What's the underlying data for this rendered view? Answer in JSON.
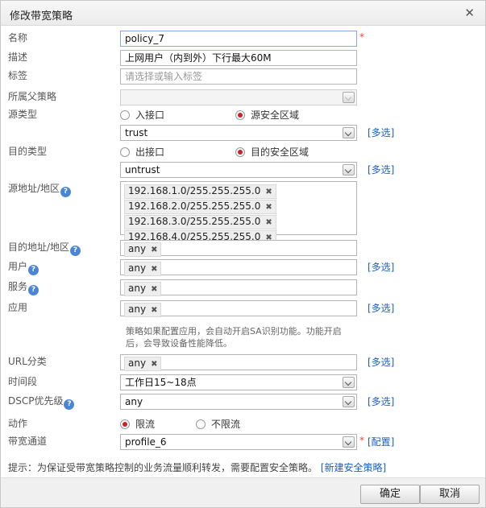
{
  "dialog": {
    "title": "修改带宽策略",
    "close_icon": "✕"
  },
  "fields": {
    "name": {
      "label": "名称",
      "value": "policy_7",
      "required_mark": "*"
    },
    "description": {
      "label": "描述",
      "value": "上网用户（内到外）下行最大60M"
    },
    "tag": {
      "label": "标签",
      "placeholder": "请选择或输入标签"
    },
    "parent_policy": {
      "label": "所属父策略",
      "value": ""
    },
    "source_type": {
      "label": "源类型",
      "options": [
        {
          "label": "入接口",
          "checked": false
        },
        {
          "label": "源安全区域",
          "checked": true
        }
      ],
      "zone_value": "trust",
      "more": "[多选]"
    },
    "dest_type": {
      "label": "目的类型",
      "options": [
        {
          "label": "出接口",
          "checked": false
        },
        {
          "label": "目的安全区域",
          "checked": true
        }
      ],
      "zone_value": "untrust",
      "more": "[多选]"
    },
    "source_address": {
      "label": "源地址/地区",
      "values": [
        "192.168.1.0/255.255.255.0",
        "192.168.2.0/255.255.255.0",
        "192.168.3.0/255.255.255.0",
        "192.168.4.0/255.255.255.0"
      ]
    },
    "dest_address": {
      "label": "目的地址/地区",
      "value": "any"
    },
    "user": {
      "label": "用户",
      "value": "any",
      "more": "[多选]"
    },
    "service": {
      "label": "服务",
      "value": "any"
    },
    "application": {
      "label": "应用",
      "value": "any",
      "more": "[多选]",
      "note": "策略如果配置应用，会自动开启SA识别功能。功能开启后，会导致设备性能降低。"
    },
    "url_category": {
      "label": "URL分类",
      "value": "any",
      "more": "[多选]"
    },
    "time_range": {
      "label": "时间段",
      "value": "工作日15~18点"
    },
    "dscp": {
      "label": "DSCP优先级",
      "value": "any",
      "more": "[多选]"
    },
    "action": {
      "label": "动作",
      "options": [
        {
          "label": "限流",
          "checked": true
        },
        {
          "label": "不限流",
          "checked": false
        }
      ]
    },
    "bandwidth_channel": {
      "label": "带宽通道",
      "value": "profile_6",
      "required_mark": "*",
      "config_link": "[配置]"
    }
  },
  "help_glyph": "?",
  "tag_remove_glyph": "✖",
  "tip": {
    "text": "提示：为保证受带宽策略控制的业务流量顺利转发，需要配置安全策略。",
    "link": "[新建安全策略]"
  },
  "buttons": {
    "ok": "确定",
    "cancel": "取消"
  }
}
